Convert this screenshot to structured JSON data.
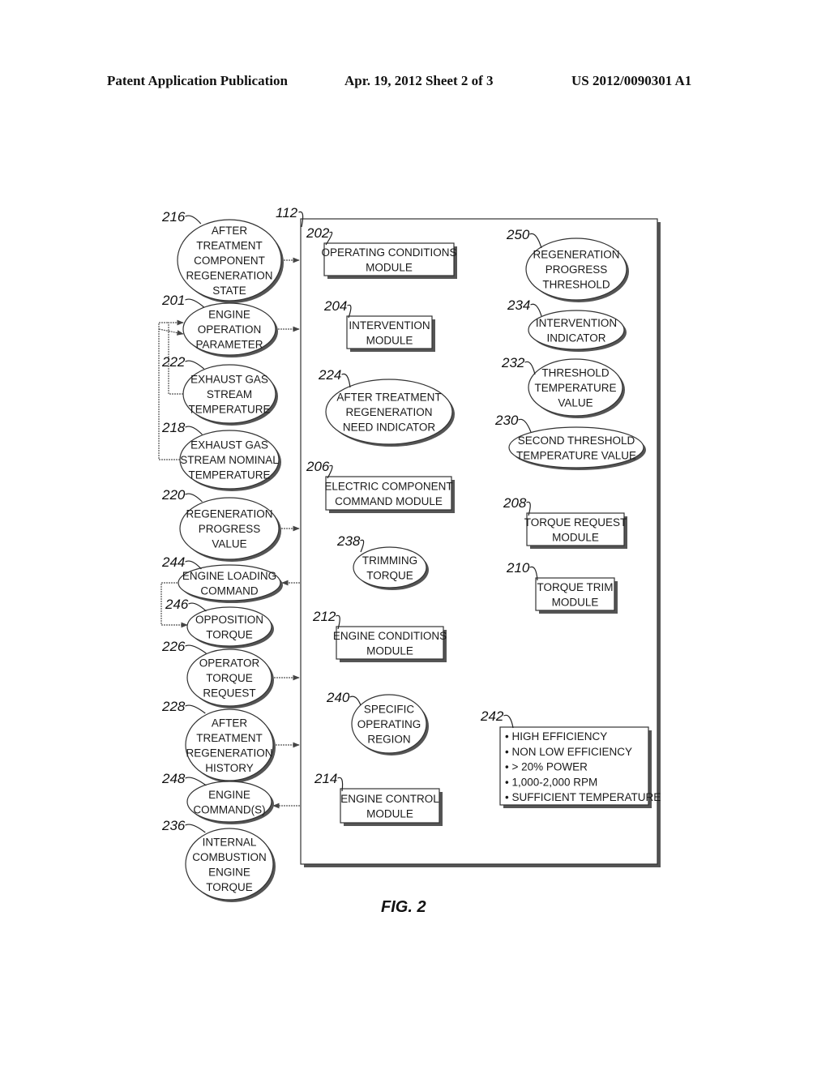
{
  "header": {
    "left": "Patent Application Publication",
    "center": "Apr. 19, 2012  Sheet 2 of 3",
    "right": "US 2012/0090301 A1"
  },
  "figure": {
    "caption": "FIG. 2",
    "container_ref": "112",
    "left_column": [
      {
        "ref": "216",
        "lines": [
          "AFTER",
          "TREATMENT",
          "COMPONENT",
          "REGENERATION",
          "STATE"
        ]
      },
      {
        "ref": "201",
        "lines": [
          "ENGINE",
          "OPERATION",
          "PARAMETER"
        ]
      },
      {
        "ref": "222",
        "lines": [
          "EXHAUST GAS",
          "STREAM",
          "TEMPERATURE"
        ]
      },
      {
        "ref": "218",
        "lines": [
          "EXHAUST GAS",
          "STREAM NOMINAL",
          "TEMPERATURE"
        ]
      },
      {
        "ref": "220",
        "lines": [
          "REGENERATION",
          "PROGRESS",
          "VALUE"
        ]
      },
      {
        "ref": "244",
        "lines": [
          "ENGINE LOADING",
          "COMMAND"
        ]
      },
      {
        "ref": "246",
        "lines": [
          "OPPOSITION",
          "TORQUE"
        ]
      },
      {
        "ref": "226",
        "lines": [
          "OPERATOR",
          "TORQUE",
          "REQUEST"
        ]
      },
      {
        "ref": "228",
        "lines": [
          "AFTER",
          "TREATMENT",
          "REGENERATION",
          "HISTORY"
        ]
      },
      {
        "ref": "248",
        "lines": [
          "ENGINE",
          "COMMAND(S)"
        ]
      },
      {
        "ref": "236",
        "lines": [
          "INTERNAL",
          "COMBUSTION",
          "ENGINE",
          "TORQUE"
        ]
      }
    ],
    "modules": {
      "operating_conditions": {
        "ref": "202",
        "lines": [
          "OPERATING CONDITIONS",
          "MODULE"
        ]
      },
      "intervention": {
        "ref": "204",
        "lines": [
          "INTERVENTION",
          "MODULE"
        ]
      },
      "electric_component": {
        "ref": "206",
        "lines": [
          "ELECTRIC COMPONENT",
          "COMMAND MODULE"
        ]
      },
      "torque_request": {
        "ref": "208",
        "lines": [
          "TORQUE REQUEST",
          "MODULE"
        ]
      },
      "torque_trim": {
        "ref": "210",
        "lines": [
          "TORQUE TRIM",
          "MODULE"
        ]
      },
      "engine_conditions": {
        "ref": "212",
        "lines": [
          "ENGINE CONDITIONS",
          "MODULE"
        ]
      },
      "engine_control": {
        "ref": "214",
        "lines": [
          "ENGINE CONTROL",
          "MODULE"
        ]
      }
    },
    "inner_ellipses": {
      "regen_need": {
        "ref": "224",
        "lines": [
          "AFTER TREATMENT",
          "REGENERATION",
          "NEED INDICATOR"
        ]
      },
      "regen_threshold": {
        "ref": "250",
        "lines": [
          "REGENERATION",
          "PROGRESS",
          "THRESHOLD"
        ]
      },
      "intervention_indicator": {
        "ref": "234",
        "lines": [
          "INTERVENTION",
          "INDICATOR"
        ]
      },
      "threshold_temp": {
        "ref": "232",
        "lines": [
          "THRESHOLD",
          "TEMPERATURE",
          "VALUE"
        ]
      },
      "second_threshold": {
        "ref": "230",
        "lines": [
          "SECOND THRESHOLD",
          "TEMPERATURE VALUE"
        ]
      },
      "trimming_torque": {
        "ref": "238",
        "lines": [
          "TRIMMING",
          "TORQUE"
        ]
      },
      "specific_region": {
        "ref": "240",
        "lines": [
          "SPECIFIC",
          "OPERATING",
          "REGION"
        ]
      }
    },
    "region_list": {
      "ref": "242",
      "items": [
        "• HIGH EFFICIENCY",
        "• NON LOW EFFICIENCY",
        "• > 20% POWER",
        "• 1,000-2,000 RPM",
        "• SUFFICIENT TEMPERATURE"
      ]
    }
  }
}
